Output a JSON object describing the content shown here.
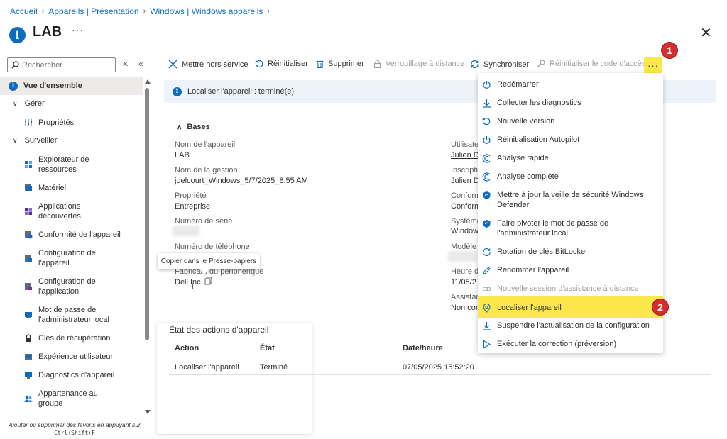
{
  "breadcrumb": [
    "Accueil",
    "Appareils | Présentation",
    "Windows | Windows appareils"
  ],
  "header": {
    "title": "LAB",
    "more": "···",
    "close": "✕"
  },
  "sidebar": {
    "search_placeholder": "Rechercher",
    "items": [
      {
        "label": "Vue d'ensemble"
      },
      {
        "label": "Gérer"
      },
      {
        "label": "Propriétés"
      },
      {
        "label": "Surveiller"
      },
      {
        "label": "Explorateur de ressources"
      },
      {
        "label": "Matériel"
      },
      {
        "label": "Applications découvertes"
      },
      {
        "label": "Conformité de l'appareil"
      },
      {
        "label": "Configuration de l'appareil"
      },
      {
        "label": "Configuration de l'application"
      },
      {
        "label": "Mot de passe de l'administrateur local"
      },
      {
        "label": "Clés de récupération"
      },
      {
        "label": "Expérience utilisateur"
      },
      {
        "label": "Diagnostics d'appareil"
      },
      {
        "label": "Appartenance au groupe"
      }
    ],
    "favorites_note": "Ajouter ou supprimer des favoris en appuyant sur",
    "favorites_shortcut": "Ctrl+Shift+F"
  },
  "toolbar": {
    "retire": "Mettre hors service",
    "reset": "Réinitialiser",
    "delete": "Supprimer",
    "remote_lock": "Verrouillage à distance",
    "sync": "Synchroniser",
    "reset_passcode": "Réinitialiser le code d'accès",
    "more": "···"
  },
  "banner": {
    "text": "Localiser l'appareil : terminé(e)"
  },
  "essentials": {
    "section_title": "Bases",
    "left": [
      {
        "label": "Nom de l'appareil",
        "value": "LAB"
      },
      {
        "label": "Nom de la gestion",
        "value": "jdelcourt_Windows_5/7/2025_8:55 AM"
      },
      {
        "label": "Propriété",
        "value": "Entreprise"
      },
      {
        "label": "Numéro de série",
        "value": ""
      },
      {
        "label": "Numéro de téléphone",
        "value": ""
      },
      {
        "label": "Fabricant du périphérique",
        "value": "Dell Inc."
      }
    ],
    "right_labels": [
      "Utilisate",
      "Inscripti",
      "Conform",
      "Système",
      "Modèle",
      "Heure d",
      "Assistan"
    ],
    "right_values": [
      "Julien D",
      "Julien D",
      "Conform",
      "Window",
      "",
      "11/05/2",
      "Non cor"
    ]
  },
  "tooltip": "Copier dans le Presse-papiers",
  "actions": {
    "title": "État des actions d'appareil",
    "columns": [
      "Action",
      "État",
      "Date/heure"
    ],
    "rows": [
      {
        "action": "Localiser l'appareil",
        "state": "Terminé",
        "datetime": "07/05/2025 15:52:20"
      }
    ]
  },
  "menu": {
    "items": [
      {
        "label": "Redémarrer"
      },
      {
        "label": "Collecter les diagnostics"
      },
      {
        "label": "Nouvelle version"
      },
      {
        "label": "Réinitialisation Autopilot"
      },
      {
        "label": "Analyse rapide"
      },
      {
        "label": "Analyse complète"
      },
      {
        "label": "Mettre à jour la veille de sécurité Windows Defender"
      },
      {
        "label": "Faire pivoter le mot de passe de l'administrateur local"
      },
      {
        "label": "Rotation de clés BitLocker"
      },
      {
        "label": "Renommer l'appareil"
      },
      {
        "label": "Nouvelle session d'assistance à distance"
      },
      {
        "label": "Localiser l'appareil"
      },
      {
        "label": "Suspendre l'actualisation de la configuration"
      },
      {
        "label": "Exécuter la correction (préversion)"
      }
    ]
  },
  "badges": [
    "1",
    "2"
  ],
  "colors": {
    "accent": "#0f6cbd",
    "highlight": "#fbe74a",
    "badge": "#d92c2c"
  }
}
